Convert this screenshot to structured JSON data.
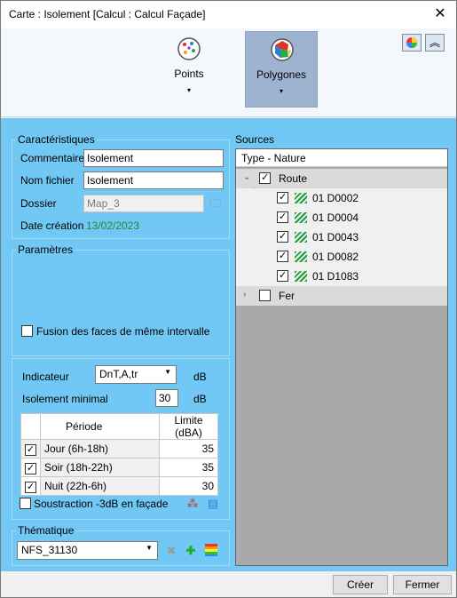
{
  "window": {
    "title": "Carte : Isolement [Calcul : Calcul Façade]"
  },
  "ribbon": {
    "points_label": "Points",
    "polygones_label": "Polygones",
    "dropdown_glyph": "▾"
  },
  "caracteristiques": {
    "title": "Caractéristiques",
    "commentaire_label": "Commentaire",
    "commentaire_value": "Isolement",
    "nom_fichier_label": "Nom fichier",
    "nom_fichier_value": "Isolement",
    "dossier_label": "Dossier",
    "dossier_value": "Map_3",
    "date_label": "Date création",
    "date_value": "13/02/2023"
  },
  "parametres": {
    "title": "Paramètres",
    "fusion_label": "Fusion des faces de même intervalle",
    "fusion_checked": false,
    "indicateur_label": "Indicateur",
    "indicateur_value": "DnT,A,tr",
    "indicateur_unit": "dB",
    "isolement_label": "Isolement minimal",
    "isolement_value": "30",
    "isolement_unit": "dB",
    "table": {
      "headers": [
        "Période",
        "Limite (dBA)"
      ],
      "rows": [
        {
          "periode": "Jour (6h-18h)",
          "limite": "35",
          "checked": true
        },
        {
          "periode": "Soir (18h-22h)",
          "limite": "35",
          "checked": true
        },
        {
          "periode": "Nuit (22h-6h)",
          "limite": "30",
          "checked": true
        }
      ]
    },
    "soustraction_label": "Soustraction -3dB en façade",
    "soustraction_checked": false
  },
  "thematique": {
    "title": "Thématique",
    "value": "NFS_31130"
  },
  "sources": {
    "title": "Sources",
    "header": "Type - Nature",
    "groups": [
      {
        "label": "Route",
        "expanded": true,
        "checked": true,
        "children": [
          "01 D0002",
          "01 D0004",
          "01 D0043",
          "01 D0082",
          "01 D1083"
        ]
      },
      {
        "label": "Fer",
        "expanded": false,
        "checked": false,
        "children": []
      }
    ]
  },
  "footer": {
    "creer": "Créer",
    "fermer": "Fermer"
  }
}
